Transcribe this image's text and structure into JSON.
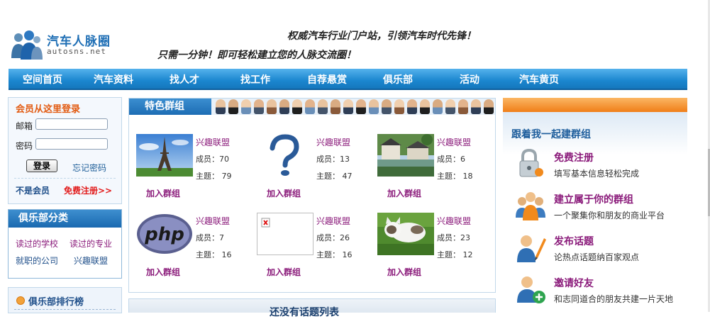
{
  "header": {
    "brand": "汽车人脉圈",
    "domain": "autosns.net",
    "slogan_1": "权威汽车行业门户站，引领汽车时代先锋！",
    "slogan_2": "只需一分钟！即可轻松建立您的人脉交流圈！"
  },
  "nav": [
    {
      "label": "空间首页"
    },
    {
      "label": "汽车资料"
    },
    {
      "label": "找人才"
    },
    {
      "label": "找工作"
    },
    {
      "label": "自荐悬赏"
    },
    {
      "label": "俱乐部"
    },
    {
      "label": "活动"
    },
    {
      "label": "汽车黄页"
    }
  ],
  "login": {
    "title": "会员从这里登录",
    "email_label": "邮箱",
    "email_value": "",
    "password_label": "密码",
    "password_value": "",
    "submit_label": "登录",
    "forgot_label": "忘记密码",
    "not_member_label": "不是会员",
    "register_label": "免费注册>>"
  },
  "club_categories": {
    "title": "俱乐部分类",
    "items": [
      "读过的学校",
      "读过的专业",
      "就职的公司",
      "兴趣联盟"
    ]
  },
  "club_ranking": {
    "title": "俱乐部排行榜"
  },
  "featured_groups": {
    "title": "特色群组",
    "groups": [
      {
        "name": "兴趣联盟",
        "members": "成员：70",
        "topics": "主题： 79",
        "join": "加入群组",
        "image": "eiffel-tower-photo"
      },
      {
        "name": "兴趣联盟",
        "members": "成员：13",
        "topics": "主题： 47",
        "join": "加入群组",
        "image": "question-mark-image"
      },
      {
        "name": "兴趣联盟",
        "members": "成员：6",
        "topics": "主题： 18",
        "join": "加入群组",
        "image": "village-photo"
      },
      {
        "name": "兴趣联盟",
        "members": "成员：7",
        "topics": "主题： 16",
        "join": "加入群组",
        "image": "php-logo"
      },
      {
        "name": "兴趣联盟",
        "members": "成员：26",
        "topics": "主题： 16",
        "join": "加入群组",
        "image": "broken-image"
      },
      {
        "name": "兴趣联盟",
        "members": "成员：23",
        "topics": "主题： 12",
        "join": "加入群组",
        "image": "kitten-photo"
      }
    ]
  },
  "topics_bar": {
    "title": "还没有话题列表"
  },
  "steps": {
    "title": "跟着我一起建群组",
    "items": [
      {
        "title": "免费注册",
        "desc": "填写基本信息轻松完成",
        "icon": "lock-icon"
      },
      {
        "title": "建立属于你的群组",
        "desc": "一个聚集你和朋友的商业平台",
        "icon": "group-icon"
      },
      {
        "title": "发布话题",
        "desc": "论热点话题纳百家观点",
        "icon": "pen-user-icon"
      },
      {
        "title": "邀请好友",
        "desc": "和志同道合的朋友共建一片天地",
        "icon": "add-user-icon"
      }
    ]
  },
  "colors": {
    "nav_blue": "#1b86cf",
    "link_purple": "#8a1a7a",
    "register_red": "#e21b1b",
    "accent_orange": "#f07e18",
    "heading_blue": "#1d5d9c"
  }
}
